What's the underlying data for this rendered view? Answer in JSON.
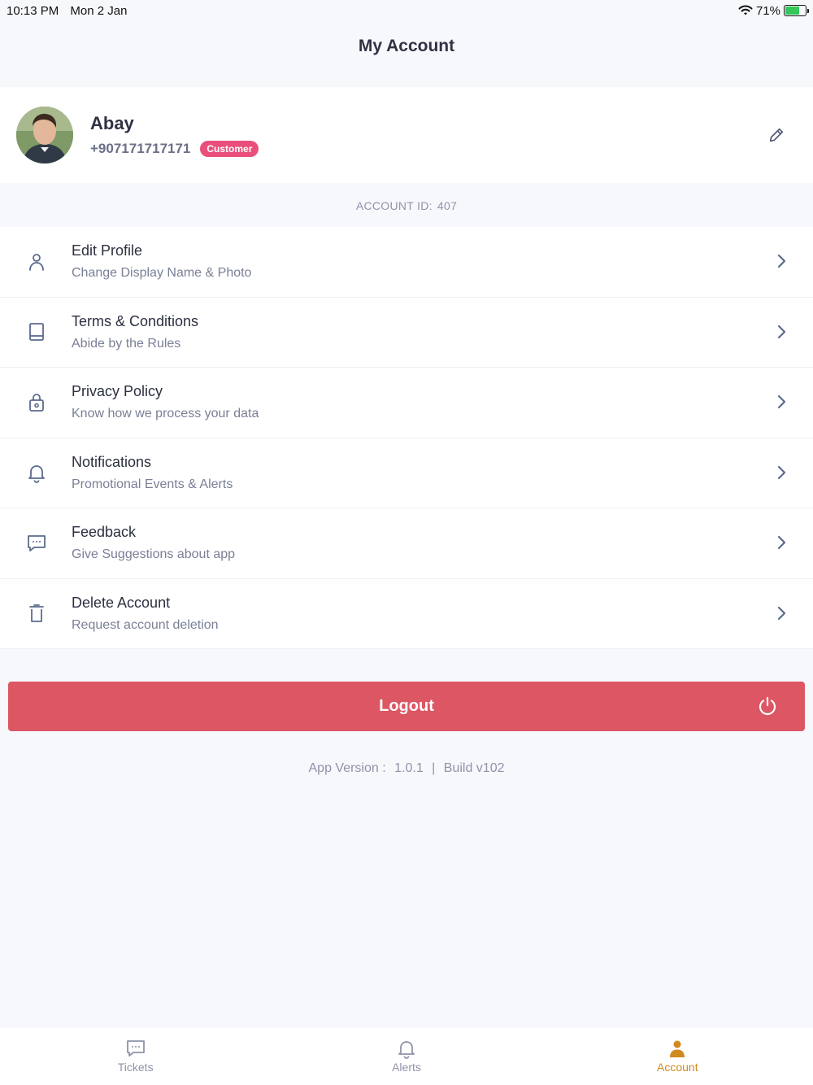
{
  "status_bar": {
    "time": "10:13 PM",
    "date": "Mon 2 Jan",
    "battery": "71%",
    "battery_level": 0.71
  },
  "page_title": "My Account",
  "profile": {
    "name": "Abay",
    "phone": "+907171717171",
    "role": "Customer"
  },
  "account": {
    "label": "ACCOUNT ID:",
    "id": "407"
  },
  "menu": [
    {
      "title": "Edit Profile",
      "subtitle": "Change Display Name & Photo",
      "icon": "user-icon"
    },
    {
      "title": "Terms & Conditions",
      "subtitle": "Abide by the Rules",
      "icon": "book-icon"
    },
    {
      "title": "Privacy Policy",
      "subtitle": "Know how we process your data",
      "icon": "lock-icon"
    },
    {
      "title": "Notifications",
      "subtitle": "Promotional Events & Alerts",
      "icon": "bell-icon"
    },
    {
      "title": "Feedback",
      "subtitle": "Give Suggestions about app",
      "icon": "message-icon"
    },
    {
      "title": "Delete Account",
      "subtitle": "Request account deletion",
      "icon": "trash-icon"
    }
  ],
  "logout_label": "Logout",
  "app_version": {
    "label": "App Version :",
    "version": "1.0.1",
    "separator": "|",
    "build": "Build v102"
  },
  "tabs": [
    {
      "label": "Tickets",
      "icon": "message-icon",
      "active": false
    },
    {
      "label": "Alerts",
      "icon": "bell-icon",
      "active": false
    },
    {
      "label": "Account",
      "icon": "person-icon",
      "active": true
    }
  ],
  "colors": {
    "accent_red": "#dd5664",
    "badge_pink": "#e94f7a",
    "active_tab": "#d18a1e",
    "icon_gray": "#5b6b8c",
    "background": "#f7f8fc"
  }
}
